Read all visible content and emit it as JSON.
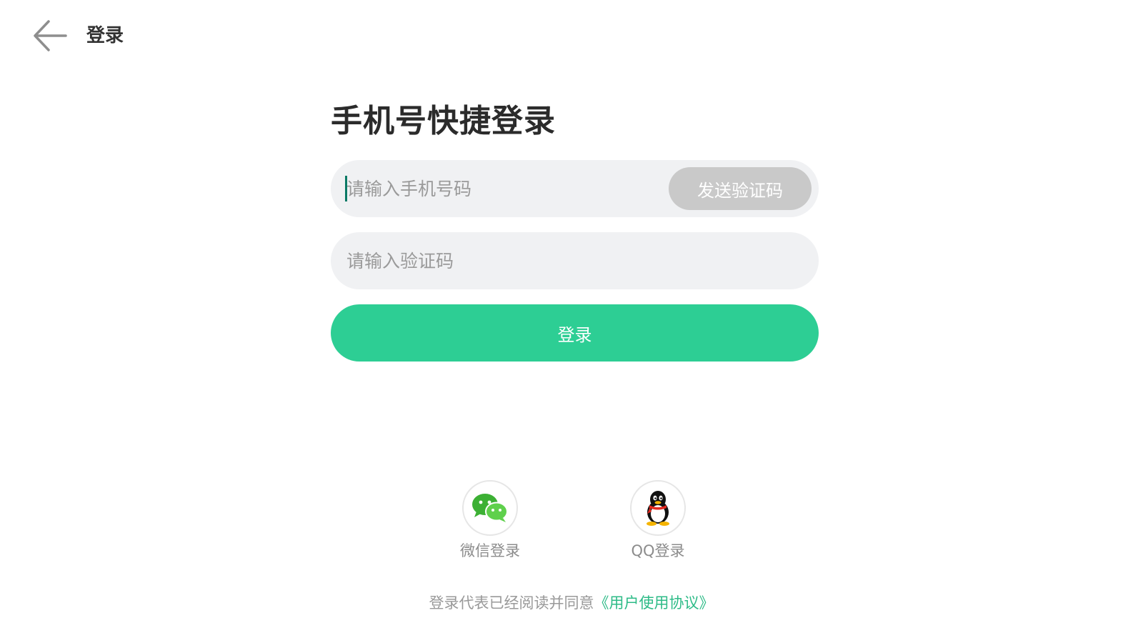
{
  "header": {
    "back_icon": "arrow-left-icon",
    "title": "登录"
  },
  "form": {
    "title": "手机号快捷登录",
    "phone_placeholder": "请输入手机号码",
    "send_code_label": "发送验证码",
    "code_placeholder": "请输入验证码",
    "login_label": "登录"
  },
  "social": {
    "wechat": {
      "icon": "wechat-icon",
      "label": "微信登录"
    },
    "qq": {
      "icon": "qq-penguin-icon",
      "label": "QQ登录"
    }
  },
  "agreement": {
    "prefix": "登录代表已经阅读并同意",
    "link": "《用户使用协议》"
  },
  "colors": {
    "accent": "#2dce94",
    "input_bg": "#f0f1f3",
    "send_code_bg": "#c9c9c9",
    "link": "#2dbb87"
  }
}
